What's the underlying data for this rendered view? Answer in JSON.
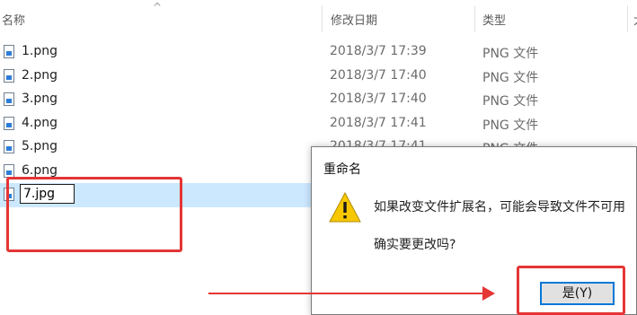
{
  "explorer": {
    "columns": {
      "name": "名称",
      "date": "修改日期",
      "type": "类型",
      "size_partial": "大"
    },
    "sort_indicator": "^",
    "files": [
      {
        "name": "1.png",
        "date": "2018/3/7 17:39",
        "type": "PNG 文件"
      },
      {
        "name": "2.png",
        "date": "2018/3/7 17:40",
        "type": "PNG 文件"
      },
      {
        "name": "3.png",
        "date": "2018/3/7 17:40",
        "type": "PNG 文件"
      },
      {
        "name": "4.png",
        "date": "2018/3/7 17:41",
        "type": "PNG 文件"
      },
      {
        "name": "5.png",
        "date": "2018/3/7 17:41",
        "type": "PNG 文件"
      },
      {
        "name": "6.png",
        "date": "",
        "type": ""
      }
    ],
    "rename_row": {
      "value": "7.jpg"
    }
  },
  "dialog": {
    "title": "重命名",
    "message": "如果改变文件扩展名，可能会导致文件不可用",
    "question": "确实要更改吗?",
    "yes_label": "是(Y)",
    "icon": "warning-icon"
  },
  "annotations": {
    "highlight_color": "#e53535",
    "selection_color": "#cce8ff",
    "accent_color": "#0078d7"
  }
}
